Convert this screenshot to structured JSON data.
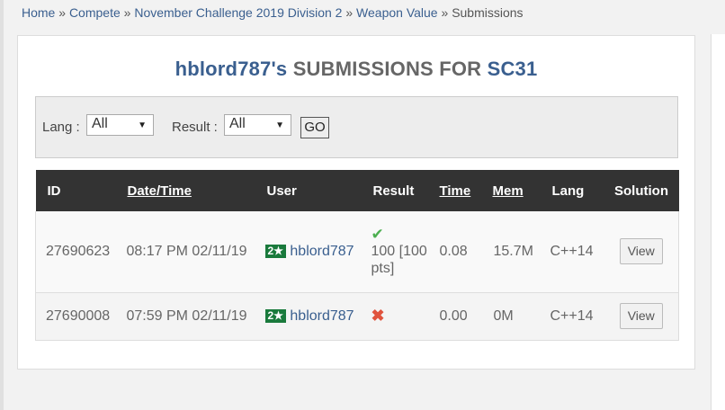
{
  "breadcrumb": {
    "home": "Home",
    "compete": "Compete",
    "contest": "November Challenge 2019 Division 2",
    "problem": "Weapon Value",
    "current": "Submissions",
    "separator": "»"
  },
  "title": {
    "user": "hblord787's",
    "middle": "SUBMISSIONS FOR",
    "problem_code": "SC31"
  },
  "filter": {
    "lang_label": "Lang :",
    "lang_value": "All",
    "result_label": "Result :",
    "result_value": "All",
    "go_label": "GO"
  },
  "table": {
    "headers": {
      "id": "ID",
      "datetime": "Date/Time",
      "user": "User",
      "result": "Result",
      "time": "Time",
      "mem": "Mem",
      "lang": "Lang",
      "solution": "Solution"
    },
    "rows": [
      {
        "id": "27690623",
        "datetime": "08:17 PM 02/11/19",
        "stars": "2★",
        "user": "hblord787",
        "result_icon": "check-icon",
        "result_text": "100 [100pts]",
        "time": "0.08",
        "mem": "15.7M",
        "lang": "C++14",
        "solution": "View"
      },
      {
        "id": "27690008",
        "datetime": "07:59 PM 02/11/19",
        "stars": "2★",
        "user": "hblord787",
        "result_icon": "cross-icon",
        "result_text": "",
        "time": "0.00",
        "mem": "0M",
        "lang": "C++14",
        "solution": "View"
      }
    ]
  },
  "colors": {
    "link": "#3a5f8f",
    "header_bg": "#333333",
    "star_badge": "#1a7a3c",
    "accepted": "#4caf50",
    "wrong": "#e0533d"
  }
}
